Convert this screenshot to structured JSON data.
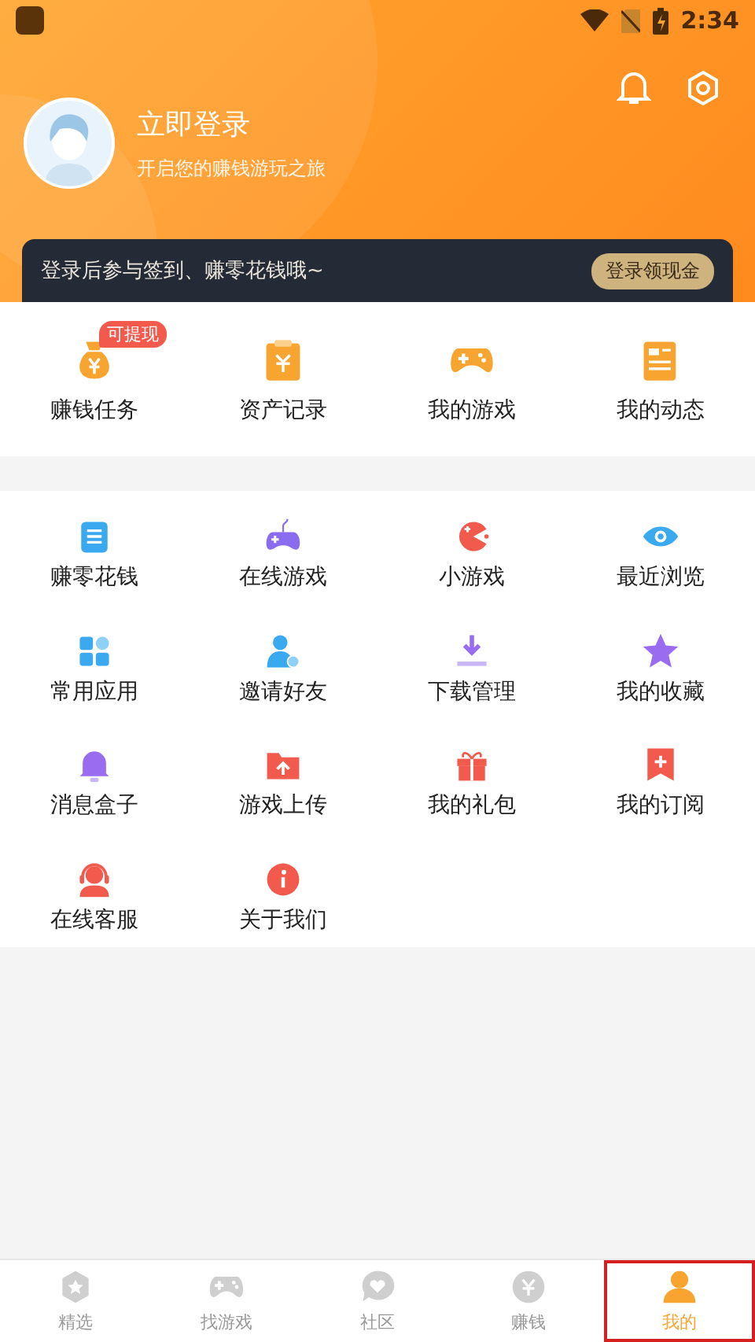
{
  "status_bar": {
    "time": "2:34"
  },
  "profile": {
    "title": "立即登录",
    "subtitle": "开启您的赚钱游玩之旅"
  },
  "banner": {
    "text": "登录后参与签到、赚零花钱哦~",
    "button": "登录领现金"
  },
  "main_items": [
    {
      "label": "赚钱任务",
      "badge": "可提现"
    },
    {
      "label": "资产记录"
    },
    {
      "label": "我的游戏"
    },
    {
      "label": "我的动态"
    }
  ],
  "tools": [
    {
      "label": "赚零花钱"
    },
    {
      "label": "在线游戏"
    },
    {
      "label": "小游戏"
    },
    {
      "label": "最近浏览"
    },
    {
      "label": "常用应用"
    },
    {
      "label": "邀请好友"
    },
    {
      "label": "下载管理"
    },
    {
      "label": "我的收藏"
    },
    {
      "label": "消息盒子"
    },
    {
      "label": "游戏上传"
    },
    {
      "label": "我的礼包"
    },
    {
      "label": "我的订阅"
    },
    {
      "label": "在线客服"
    },
    {
      "label": "关于我们"
    }
  ],
  "tabs": [
    {
      "label": "精选",
      "selected": false
    },
    {
      "label": "找游戏",
      "selected": false
    },
    {
      "label": "社区",
      "selected": false
    },
    {
      "label": "赚钱",
      "selected": false
    },
    {
      "label": "我的",
      "selected": true
    }
  ]
}
